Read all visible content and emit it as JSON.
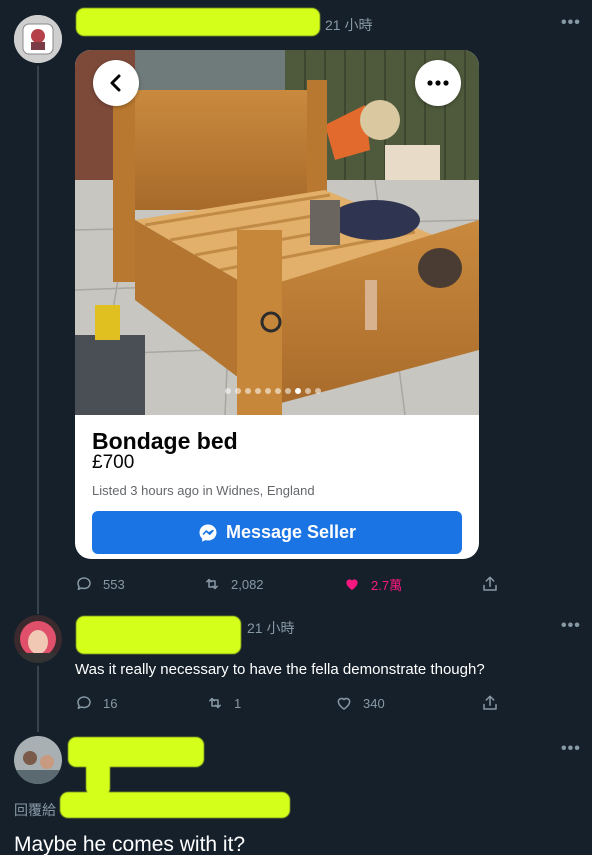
{
  "tweet1": {
    "time": "21 小時",
    "listing": {
      "title": "Bondage bed",
      "price": "£700",
      "meta": "Listed 3 hours ago in Widnes, England",
      "button": "Message Seller"
    },
    "photo_dots_total": 10,
    "photo_dots_active": 8,
    "replies": "553",
    "retweets": "2,082",
    "likes": "2.7萬",
    "liked": true,
    "colors": {
      "like": "#f91880",
      "accent": "#1b74e4"
    }
  },
  "tweet2": {
    "time": "21 小時",
    "text": "Was it really necessary to have the fella demonstrate though?",
    "replies": "16",
    "retweets": "1",
    "likes": "340"
  },
  "tweet3": {
    "replying_to_label": "回覆給",
    "text": "Maybe he comes with it?"
  },
  "icons": [
    "reply-icon",
    "retweet-icon",
    "like-icon",
    "share-icon",
    "more-icon",
    "back-chevron-icon",
    "messenger-icon"
  ]
}
